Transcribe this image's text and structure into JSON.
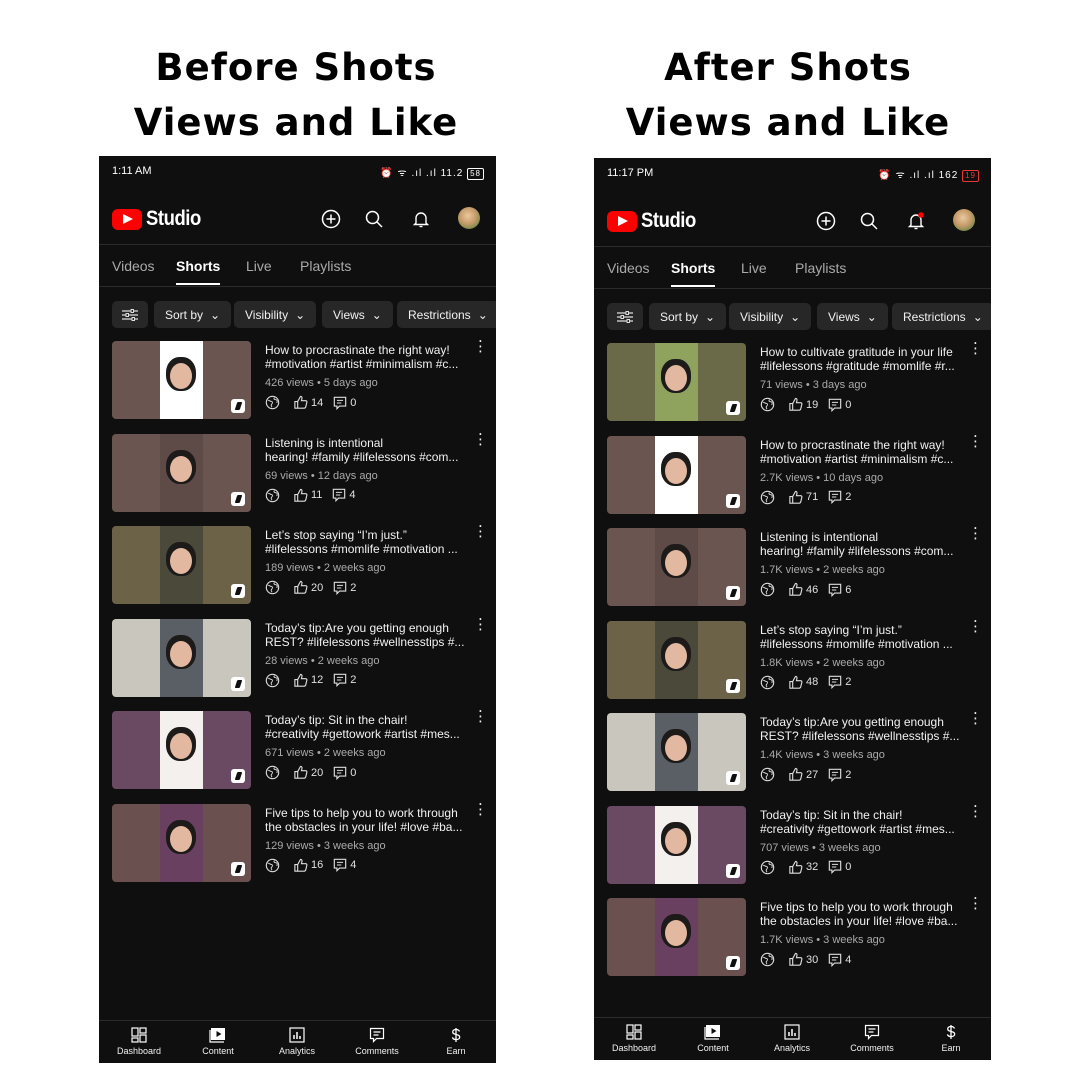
{
  "headings": {
    "before": [
      "Before Shots",
      "Views and Like"
    ],
    "after": [
      "After Shots",
      "Views and Like"
    ]
  },
  "colors": {
    "brand_red": "#ff0000",
    "background": "#0f0f0f",
    "chip": "#272727",
    "muted_text": "#aaaaaa",
    "notification_dot": "#ff0000"
  },
  "brand": {
    "name": "Studio",
    "logo_icon": "youtube-play-logo"
  },
  "tabs": [
    "Videos",
    "Shorts",
    "Live",
    "Playlists"
  ],
  "active_tab": "Shorts",
  "filters": [
    "Sort by",
    "Visibility",
    "Views",
    "Restrictions"
  ],
  "bottom_nav": [
    "Dashboard",
    "Content",
    "Analytics",
    "Comments",
    "Earn"
  ],
  "before": {
    "status": {
      "time": "1:11 AM",
      "icons": "⏰ ᯤ .ıl .ıl",
      "speed": "11.2",
      "battery": "58"
    },
    "videos": [
      {
        "title1": "How to procrastinate the right way!",
        "title2": "#motivation #artist #minimalism #c...",
        "meta": "426 views • 5 days ago",
        "likes": "14",
        "comments": "0"
      },
      {
        "title1": "Listening is intentional",
        "title2": "hearing! #family #lifelessons #com...",
        "meta": "69 views • 12 days ago",
        "likes": "11",
        "comments": "4"
      },
      {
        "title1": "Let’s stop saying “I’m just.”",
        "title2": "#lifelessons #momlife #motivation ...",
        "meta": "189 views • 2 weeks ago",
        "likes": "20",
        "comments": "2"
      },
      {
        "title1": "Today’s tip:Are you getting enough",
        "title2": "REST? #lifelessons #wellnesstips #...",
        "meta": "28 views • 2 weeks ago",
        "likes": "12",
        "comments": "2"
      },
      {
        "title1": "Today’s tip: Sit in the chair!",
        "title2": "#creativity #gettowork #artist #mes...",
        "meta": "671 views • 2 weeks ago",
        "likes": "20",
        "comments": "0"
      },
      {
        "title1": "Five tips to help you to work through",
        "title2": "the obstacles in your life! #love #ba...",
        "meta": "129 views • 3 weeks ago",
        "likes": "16",
        "comments": "4"
      }
    ]
  },
  "after": {
    "status": {
      "time": "11:17 PM",
      "icons": "⏰ ᯤ .ıl .ıl",
      "speed": "162",
      "battery": "19"
    },
    "videos": [
      {
        "title1": "How to cultivate gratitude in your life",
        "title2": "#lifelessons #gratitude #momlife #r...",
        "meta": "71 views • 3 days ago",
        "likes": "19",
        "comments": "0"
      },
      {
        "title1": "How to procrastinate the right way!",
        "title2": "#motivation #artist #minimalism #c...",
        "meta": "2.7K views • 10 days ago",
        "likes": "71",
        "comments": "2"
      },
      {
        "title1": "Listening is intentional",
        "title2": "hearing! #family #lifelessons #com...",
        "meta": "1.7K views • 2 weeks ago",
        "likes": "46",
        "comments": "6"
      },
      {
        "title1": "Let’s stop saying “I’m just.”",
        "title2": "#lifelessons #momlife #motivation ...",
        "meta": "1.8K views • 2 weeks ago",
        "likes": "48",
        "comments": "2"
      },
      {
        "title1": "Today’s tip:Are you getting enough",
        "title2": "REST? #lifelessons #wellnesstips #...",
        "meta": "1.4K views • 3 weeks ago",
        "likes": "27",
        "comments": "2"
      },
      {
        "title1": "Today’s tip: Sit in the chair!",
        "title2": "#creativity #gettowork #artist #mes...",
        "meta": "707 views • 3 weeks ago",
        "likes": "32",
        "comments": "0"
      },
      {
        "title1": "Five tips to help you to work through",
        "title2": "the obstacles in your life! #love #ba...",
        "meta": "1.7K views • 3 weeks ago",
        "likes": "30",
        "comments": "4"
      }
    ]
  }
}
